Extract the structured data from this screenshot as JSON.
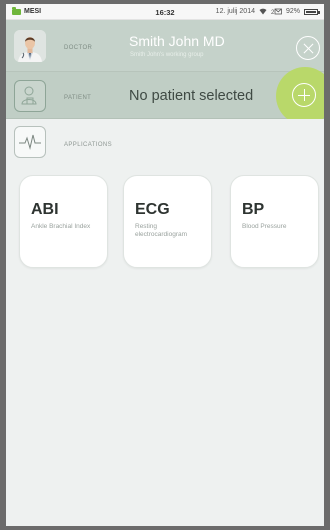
{
  "statusbar": {
    "app_name": "MESI",
    "time": "16:32",
    "date": "12. julij 2014",
    "battery": "92%"
  },
  "doctor": {
    "label": "DOCTOR",
    "name": "Smith John MD",
    "group": "Smith John's working group"
  },
  "patient": {
    "label": "PATIENT",
    "value": "No patient selected"
  },
  "applications": {
    "label": "APPLICATIONS",
    "cards": [
      {
        "abbr": "ABI",
        "desc": "Ankle Brachial Index"
      },
      {
        "abbr": "ECG",
        "desc": "Resting electrocardiogram"
      },
      {
        "abbr": "BP",
        "desc": "Blood Pressure"
      }
    ]
  },
  "colors": {
    "header_bg": "#c5d2ca",
    "accent_green": "#b9d86a",
    "background": "#eef1f0"
  }
}
